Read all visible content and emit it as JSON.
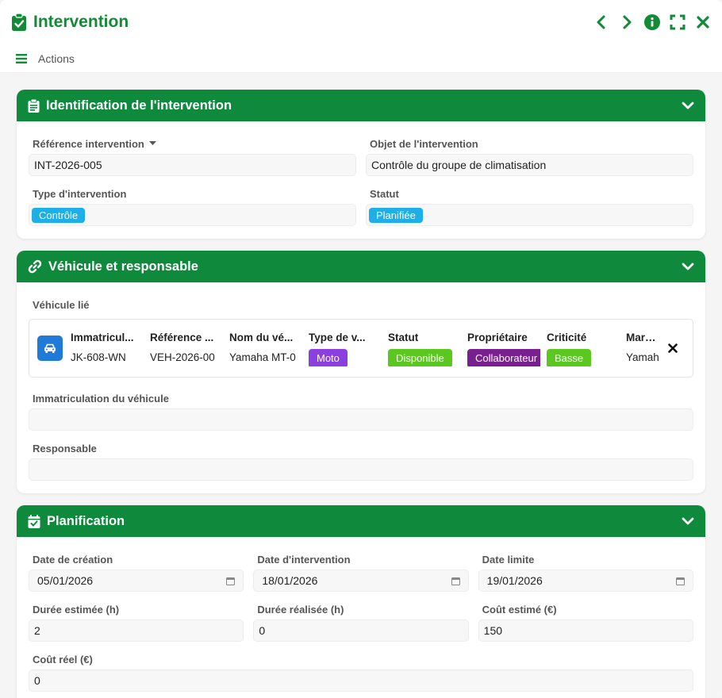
{
  "window": {
    "title": "Intervention",
    "icons": [
      "clipboard-check-icon",
      "chevron-left-icon",
      "chevron-right-icon",
      "info-icon",
      "expand-icon",
      "close-icon"
    ],
    "accent_color": "#138a36"
  },
  "actions_bar": {
    "label": "Actions",
    "icon": "hamburger-menu-icon"
  },
  "section_identification": {
    "title": "Identification de l'intervention",
    "reference_label": "Référence intervention",
    "reference_value": "INT-2026-005",
    "objet_label": "Objet de l'intervention",
    "objet_value": "Contrôle du groupe de climatisation",
    "type_label": "Type d'intervention",
    "type_value": "Contrôle",
    "type_color": "#1eaee8",
    "statut_label": "Statut",
    "statut_value": "Planifiée",
    "statut_color": "#1eaee8"
  },
  "section_vehicule": {
    "title": "Véhicule et responsable",
    "vehicule_lie_label": "Véhicule lié",
    "vehicle_headers": [
      "Immatricul...",
      "Référence ...",
      "Nom du vé...",
      "Type de v...",
      "Statut",
      "Propriétaire",
      "Criticité",
      "Marque"
    ],
    "vehicle_row": {
      "immatriculation": "JK-608-WN",
      "reference": "VEH-2026-00",
      "nom": "Yamaha MT-0",
      "type": "Moto",
      "type_color": "#8b3fe0",
      "statut": "Disponible",
      "statut_color": "#5ac81e",
      "proprietaire": "Collaborateur",
      "proprietaire_color": "#7a1f8f",
      "criticite": "Basse",
      "criticite_color": "#5ac81e",
      "marque": "Yamaha"
    },
    "immatriculation_label": "Immatriculation du véhicule",
    "immatriculation_value": "",
    "responsable_label": "Responsable",
    "responsable_value": ""
  },
  "section_planification": {
    "title": "Planification",
    "date_creation_label": "Date de création",
    "date_creation_value": "05/01/2026",
    "date_intervention_label": "Date d'intervention",
    "date_intervention_value": "18/01/2026",
    "date_limite_label": "Date limite",
    "date_limite_value": "19/01/2026",
    "duree_estimee_label": "Durée estimée (h)",
    "duree_estimee_value": "2",
    "duree_realisee_label": "Durée réalisée (h)",
    "duree_realisee_value": "0",
    "cout_estime_label": "Coût estimé (€)",
    "cout_estime_value": "150",
    "cout_reel_label": "Coût réel (€)",
    "cout_reel_value": "0"
  }
}
